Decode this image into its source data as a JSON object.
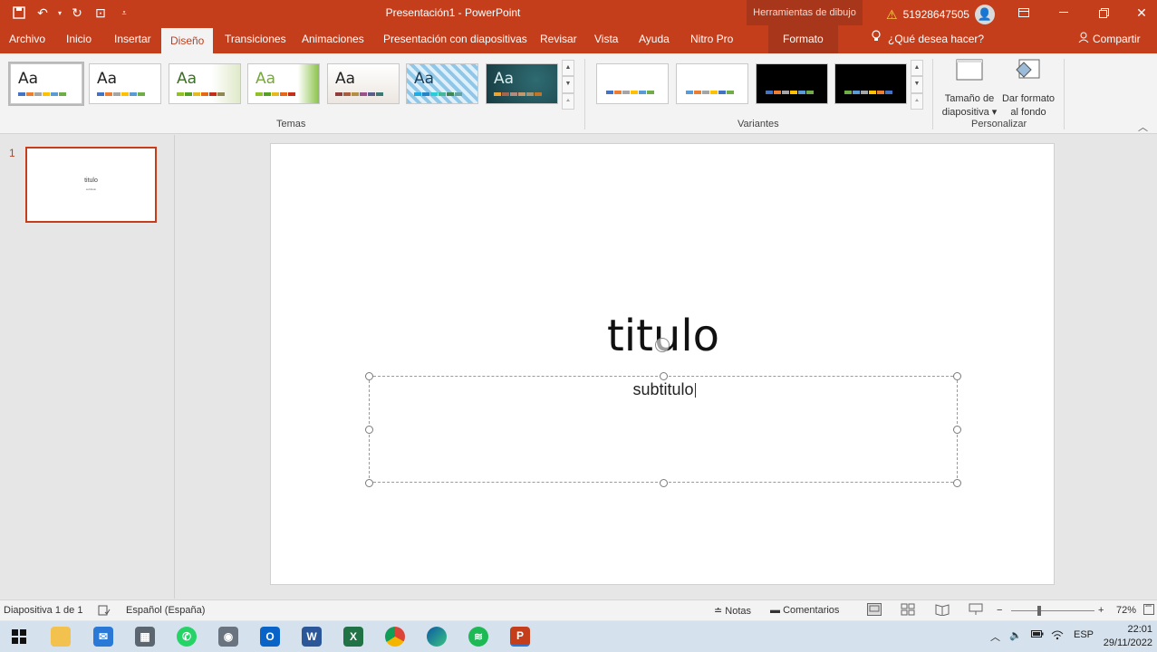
{
  "app": {
    "document_title": "Presentación1  -  PowerPoint",
    "context_tools": "Herramientas de dibujo",
    "account_id": "51928647505"
  },
  "tabs": [
    "Archivo",
    "Inicio",
    "Insertar",
    "Diseño",
    "Transiciones",
    "Animaciones",
    "Presentación con diapositivas",
    "Revisar",
    "Vista",
    "Ayuda",
    "Nitro Pro",
    "Formato"
  ],
  "tell_me": "¿Qué desea hacer?",
  "share": "Compartir",
  "ribbon": {
    "themes_label": "Temas",
    "variants_label": "Variantes",
    "customize_label": "Personalizar",
    "theme_sample": "Aa",
    "slide_size_line1": "Tamaño de",
    "slide_size_line2": "diapositiva",
    "bg_format_line1": "Dar formato",
    "bg_format_line2": "al fondo"
  },
  "thumbnails": [
    {
      "number": "1",
      "title": "titulo",
      "subtitle": "subtitulo"
    }
  ],
  "slide": {
    "title": "titulo",
    "subtitle": "subtitulo"
  },
  "status": {
    "slide_info": "Diapositiva 1 de 1",
    "language": "Español (España)",
    "notes": "Notas",
    "comments": "Comentarios",
    "zoom": "72%"
  },
  "taskbar": {
    "lang": "ESP",
    "time": "22:01",
    "date": "29/11/2022"
  },
  "colors": {
    "accent": "#c43e1c"
  }
}
